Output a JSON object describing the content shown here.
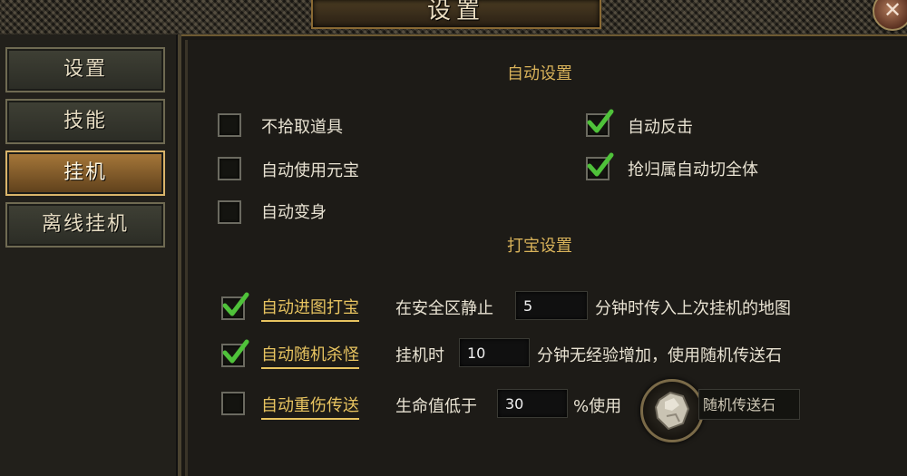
{
  "window": {
    "title": "设置",
    "close_icon": "close-icon"
  },
  "sidebar": {
    "items": [
      {
        "label": "设置",
        "active": false
      },
      {
        "label": "技能",
        "active": false
      },
      {
        "label": "挂机",
        "active": true
      },
      {
        "label": "离线挂机",
        "active": false
      }
    ]
  },
  "auto_settings": {
    "title": "自动设置",
    "options": [
      {
        "label": "不拾取道具",
        "checked": false
      },
      {
        "label": "自动使用元宝",
        "checked": false
      },
      {
        "label": "自动变身",
        "checked": false
      },
      {
        "label": "自动反击",
        "checked": true
      },
      {
        "label": "抢归属自动切全体",
        "checked": true
      }
    ]
  },
  "treasure_settings": {
    "title": "打宝设置",
    "rows": [
      {
        "label": "自动进图打宝",
        "checked": true,
        "prefix": "在安全区静止",
        "value": "5",
        "suffix": "分钟时传入上次挂机的地图"
      },
      {
        "label": "自动随机杀怪",
        "checked": true,
        "prefix": "挂机时",
        "value": "10",
        "suffix": "分钟无经验增加，使用随机传送石"
      },
      {
        "label": "自动重伤传送",
        "checked": false,
        "prefix": "生命值低于",
        "value": "30",
        "suffix": "%使用",
        "item_name": "随机传送石",
        "item_icon": "teleport-stone-icon"
      }
    ]
  },
  "colors": {
    "accent_gold": "#d8b25a",
    "link_gold": "#e8c460",
    "check_green": "#4fc23a",
    "active_tab": "#a8793a"
  }
}
